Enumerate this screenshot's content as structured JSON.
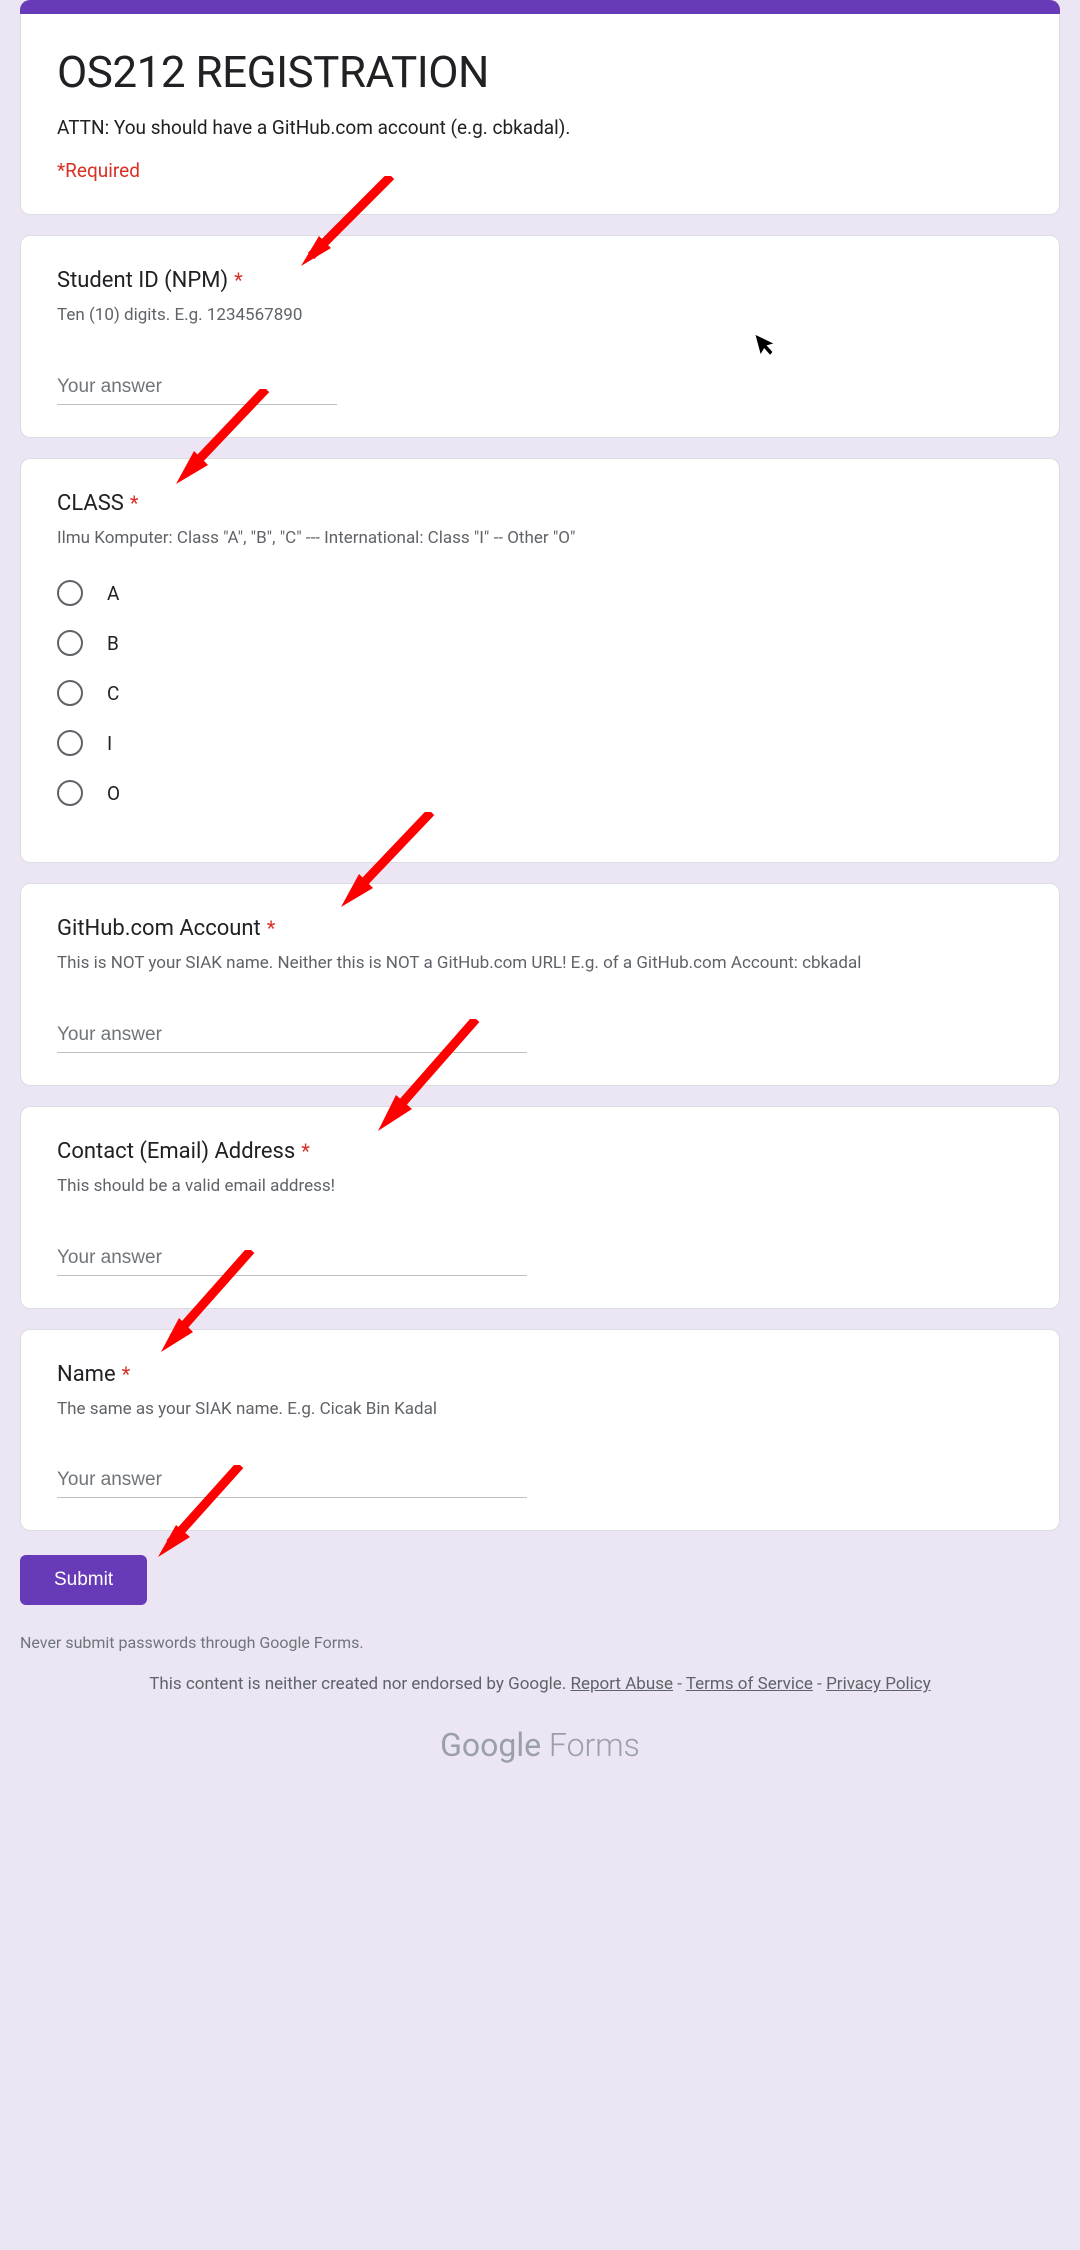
{
  "header": {
    "title": "OS212 REGISTRATION",
    "description": "ATTN: You should have a GitHub.com account (e.g. cbkadal).",
    "required_label": "*Required"
  },
  "questions": {
    "student_id": {
      "title": "Student ID (NPM)",
      "desc": "Ten (10) digits. E.g. 1234567890",
      "placeholder": "Your answer"
    },
    "class": {
      "title": "CLASS",
      "desc": "Ilmu Komputer: Class \"A\", \"B\", \"C\" --- International: Class \"I\" -- Other \"O\"",
      "options": [
        "A",
        "B",
        "C",
        "I",
        "O"
      ]
    },
    "github": {
      "title": "GitHub.com Account",
      "desc": "This is NOT your SIAK name. Neither this is NOT a GitHub.com URL! E.g. of a GitHub.com Account: cbkadal",
      "placeholder": "Your answer"
    },
    "email": {
      "title": "Contact (Email) Address",
      "desc": "This should be a valid email address!",
      "placeholder": "Your answer"
    },
    "name": {
      "title": "Name",
      "desc": "The same as your SIAK name. E.g. Cicak Bin Kadal",
      "placeholder": "Your answer"
    }
  },
  "submit_label": "Submit",
  "disclaimer": "Never submit passwords through Google Forms.",
  "legal": {
    "prefix": "This content is neither created nor endorsed by Google. ",
    "report": "Report Abuse",
    "sep": " - ",
    "terms": "Terms of Service",
    "privacy": "Privacy Policy"
  },
  "logo": {
    "google": "Google",
    "forms": " Forms"
  },
  "star": "*",
  "arrow_color": "#ff0000"
}
